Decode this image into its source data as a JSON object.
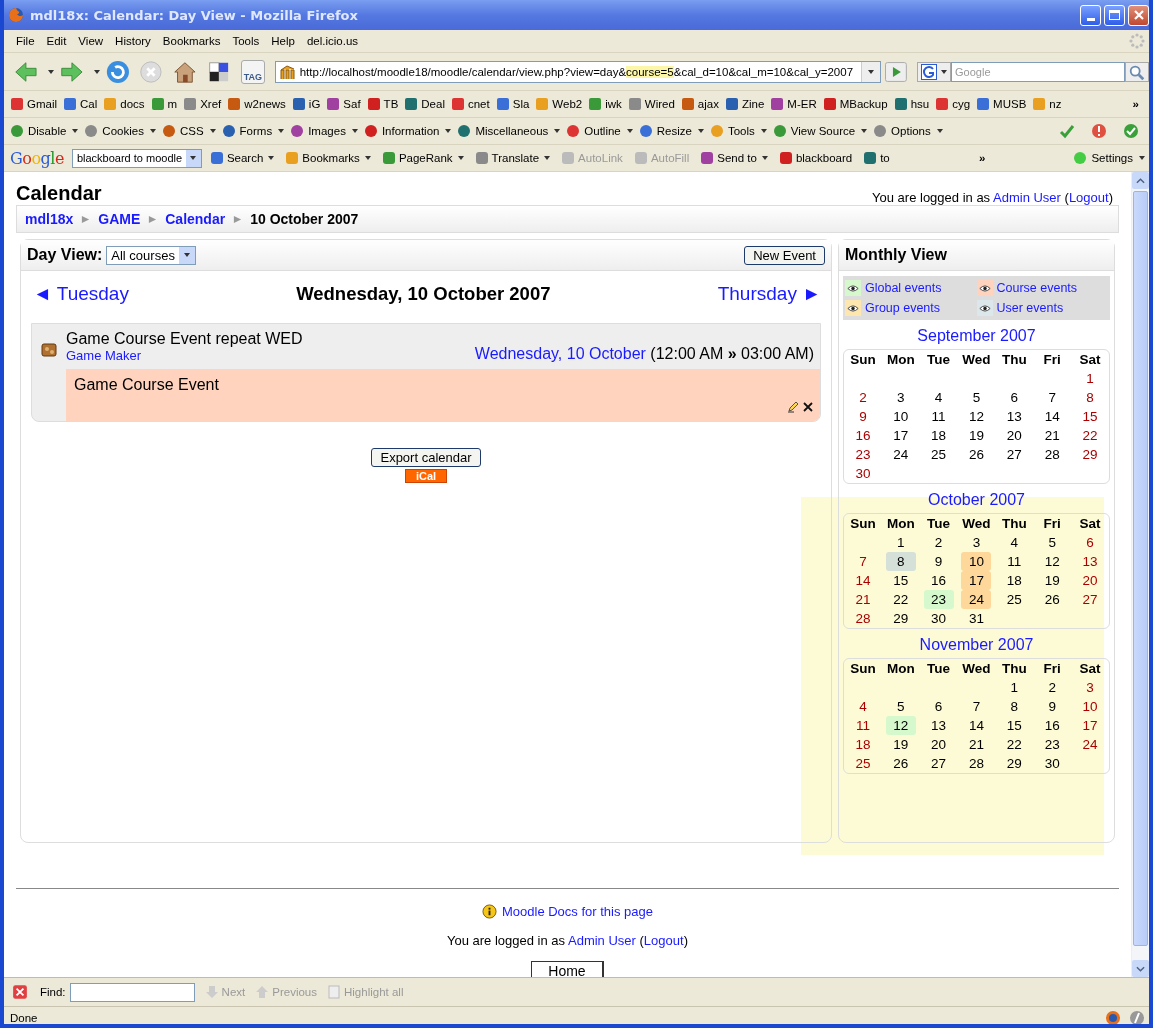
{
  "window": {
    "title": "mdl18x: Calendar: Day View - Mozilla Firefox"
  },
  "menu": [
    "File",
    "Edit",
    "View",
    "History",
    "Bookmarks",
    "Tools",
    "Help",
    "del.icio.us"
  ],
  "nav_buttons": [
    {
      "kind": "back",
      "disabled": false
    },
    {
      "kind": "forward",
      "disabled": false
    },
    {
      "kind": "reload",
      "disabled": false
    },
    {
      "kind": "stop",
      "disabled": true
    },
    {
      "kind": "home",
      "disabled": false
    },
    {
      "kind": "delicious",
      "disabled": false
    },
    {
      "kind": "tag",
      "disabled": false
    }
  ],
  "tag_label": "TAG",
  "url": [
    {
      "text": "http://localhost/moodle18/moodle/calendar/view.php?view=day&",
      "highlighted": false
    },
    {
      "text": "course=5",
      "highlighted": true
    },
    {
      "text": "&cal_d=10&cal_m=10&cal_y=2007",
      "highlighted": false
    }
  ],
  "search": {
    "placeholder": "Google"
  },
  "bookmarks": [
    "Gmail",
    "Cal",
    "docs",
    "m",
    "Xref",
    "w2news",
    "iG",
    "Saf",
    "TB",
    "Deal",
    "cnet",
    "Sla",
    "Web2",
    "iwk",
    "Wired",
    "ajax",
    "Zine",
    "M-ER",
    "MBackup",
    "hsu",
    "cyg",
    "MUSB",
    "nz"
  ],
  "bookmarks_more": "»",
  "webdev_toolbar": [
    {
      "label": "Disable",
      "dropdown": true
    },
    {
      "label": "Cookies",
      "dropdown": true
    },
    {
      "label": "CSS",
      "dropdown": true
    },
    {
      "label": "Forms",
      "dropdown": true
    },
    {
      "label": "Images",
      "dropdown": true
    },
    {
      "label": "Information",
      "dropdown": true
    },
    {
      "label": "Miscellaneous",
      "dropdown": true
    },
    {
      "label": "Outline",
      "dropdown": true
    },
    {
      "label": "Resize",
      "dropdown": true
    },
    {
      "label": "Tools",
      "dropdown": true
    },
    {
      "label": "View Source",
      "dropdown": true
    },
    {
      "label": "Options",
      "dropdown": true
    }
  ],
  "google_toolbar": {
    "logo": "Google",
    "query": "blackboard to moodle",
    "items": [
      {
        "label": "Search",
        "dropdown": true,
        "disabled": false
      },
      {
        "label": "Bookmarks",
        "dropdown": true,
        "disabled": false
      },
      {
        "label": "PageRank",
        "dropdown": true,
        "disabled": false
      },
      {
        "label": "Translate",
        "dropdown": true,
        "disabled": false
      },
      {
        "label": "AutoLink",
        "dropdown": false,
        "disabled": true
      },
      {
        "label": "AutoFill",
        "dropdown": false,
        "disabled": true
      },
      {
        "label": "Send to",
        "dropdown": true,
        "disabled": false
      },
      {
        "label": "blackboard",
        "dropdown": false,
        "disabled": false
      },
      {
        "label": "to",
        "dropdown": false,
        "disabled": false
      }
    ],
    "more": "»",
    "settings": "Settings"
  },
  "page": {
    "title": "Calendar",
    "login_prefix": "You are logged in as ",
    "user": "Admin User",
    "paren_open": "(",
    "logout": "Logout",
    "paren_close": ")",
    "breadcrumb": [
      {
        "label": "mdl18x",
        "link": true
      },
      {
        "label": "GAME",
        "link": true
      },
      {
        "label": "Calendar",
        "link": true
      },
      {
        "label": "10 October 2007",
        "link": false
      }
    ]
  },
  "day_view": {
    "label": "Day View:",
    "course_filter": "All courses",
    "new_event": "New Event",
    "prev": "◄ Tuesday",
    "next": "Thursday ►",
    "date": "Wednesday, 10 October 2007",
    "events": [
      {
        "title": "Game Course Event repeat WED",
        "course": "Game Maker",
        "date_link": "Wednesday, 10 October",
        "time": "(12:00 AM **»** 03:00 AM)",
        "description": "Game Course Event",
        "color": "#ffd3bd"
      }
    ],
    "export": "Export calendar",
    "ical": "iCal"
  },
  "monthly_view": {
    "title": "Monthly View",
    "highlighted": true,
    "legend": [
      {
        "label": "Global events",
        "color": "#d6f8cd"
      },
      {
        "label": "Course events",
        "color": "#ffd3bd"
      },
      {
        "label": "Group events",
        "color": "#fee7ae"
      },
      {
        "label": "User events",
        "color": "#dce7ec"
      }
    ],
    "months": [
      {
        "title": "September 2007",
        "weekdays": [
          "Sun",
          "Mon",
          "Tue",
          "Wed",
          "Thu",
          "Fri",
          "Sat"
        ],
        "weeks": [
          [
            {
              "n": "1"
            }
          ],
          [
            {
              "n": "2"
            },
            {
              "n": "3"
            },
            {
              "n": "4"
            },
            {
              "n": "5"
            },
            {
              "n": "6"
            },
            {
              "n": "7"
            },
            {
              "n": "8"
            }
          ],
          [
            {
              "n": "9"
            },
            {
              "n": "10"
            },
            {
              "n": "11"
            },
            {
              "n": "12"
            },
            {
              "n": "13"
            },
            {
              "n": "14"
            },
            {
              "n": "15"
            }
          ],
          [
            {
              "n": "16"
            },
            {
              "n": "17"
            },
            {
              "n": "18"
            },
            {
              "n": "19"
            },
            {
              "n": "20"
            },
            {
              "n": "21"
            },
            {
              "n": "22"
            }
          ],
          [
            {
              "n": "23"
            },
            {
              "n": "24"
            },
            {
              "n": "25"
            },
            {
              "n": "26"
            },
            {
              "n": "27"
            },
            {
              "n": "28"
            },
            {
              "n": "29"
            }
          ],
          [
            {
              "n": "30"
            }
          ]
        ]
      },
      {
        "title": "October 2007",
        "weekdays": [
          "Sun",
          "Mon",
          "Tue",
          "Wed",
          "Thu",
          "Fri",
          "Sat"
        ],
        "weeks": [
          [
            {
              "n": "1"
            },
            {
              "n": "2"
            },
            {
              "n": "3"
            },
            {
              "n": "4"
            },
            {
              "n": "5"
            },
            {
              "n": "6"
            }
          ],
          [
            {
              "n": "7"
            },
            {
              "n": "8",
              "color": "#d5e0d8"
            },
            {
              "n": "9"
            },
            {
              "n": "10",
              "color": "#fdd89a"
            },
            {
              "n": "11"
            },
            {
              "n": "12"
            },
            {
              "n": "13"
            }
          ],
          [
            {
              "n": "14"
            },
            {
              "n": "15"
            },
            {
              "n": "16"
            },
            {
              "n": "17",
              "color": "#fdd89a"
            },
            {
              "n": "18"
            },
            {
              "n": "19"
            },
            {
              "n": "20"
            }
          ],
          [
            {
              "n": "21"
            },
            {
              "n": "22"
            },
            {
              "n": "23",
              "color": "#d6f8cd"
            },
            {
              "n": "24",
              "color": "#fdd89a"
            },
            {
              "n": "25"
            },
            {
              "n": "26"
            },
            {
              "n": "27"
            }
          ],
          [
            {
              "n": "28"
            },
            {
              "n": "29"
            },
            {
              "n": "30"
            },
            {
              "n": "31"
            }
          ]
        ]
      },
      {
        "title": "November 2007",
        "weekdays": [
          "Sun",
          "Mon",
          "Tue",
          "Wed",
          "Thu",
          "Fri",
          "Sat"
        ],
        "weeks": [
          [
            {
              "n": "1"
            },
            {
              "n": "2"
            },
            {
              "n": "3"
            }
          ],
          [
            {
              "n": "4"
            },
            {
              "n": "5"
            },
            {
              "n": "6"
            },
            {
              "n": "7"
            },
            {
              "n": "8"
            },
            {
              "n": "9"
            },
            {
              "n": "10"
            }
          ],
          [
            {
              "n": "11"
            },
            {
              "n": "12",
              "color": "#d6f8cd"
            },
            {
              "n": "13"
            },
            {
              "n": "14"
            },
            {
              "n": "15"
            },
            {
              "n": "16"
            },
            {
              "n": "17"
            }
          ],
          [
            {
              "n": "18"
            },
            {
              "n": "19"
            },
            {
              "n": "20"
            },
            {
              "n": "21"
            },
            {
              "n": "22"
            },
            {
              "n": "23"
            },
            {
              "n": "24"
            }
          ],
          [
            {
              "n": "25"
            },
            {
              "n": "26"
            },
            {
              "n": "27"
            },
            {
              "n": "28"
            },
            {
              "n": "29"
            },
            {
              "n": "30"
            }
          ]
        ]
      }
    ]
  },
  "footer": {
    "docs": "Moodle Docs for this page",
    "login_prefix": "You are logged in as ",
    "user": "Admin User",
    "paren_open": "(",
    "logout": "Logout",
    "paren_close": ")",
    "home": "Home"
  },
  "find_bar": {
    "label": "Find:",
    "next": "Next",
    "previous": "Previous",
    "highlight": "Highlight all"
  },
  "status_bar": {
    "text": "Done"
  }
}
